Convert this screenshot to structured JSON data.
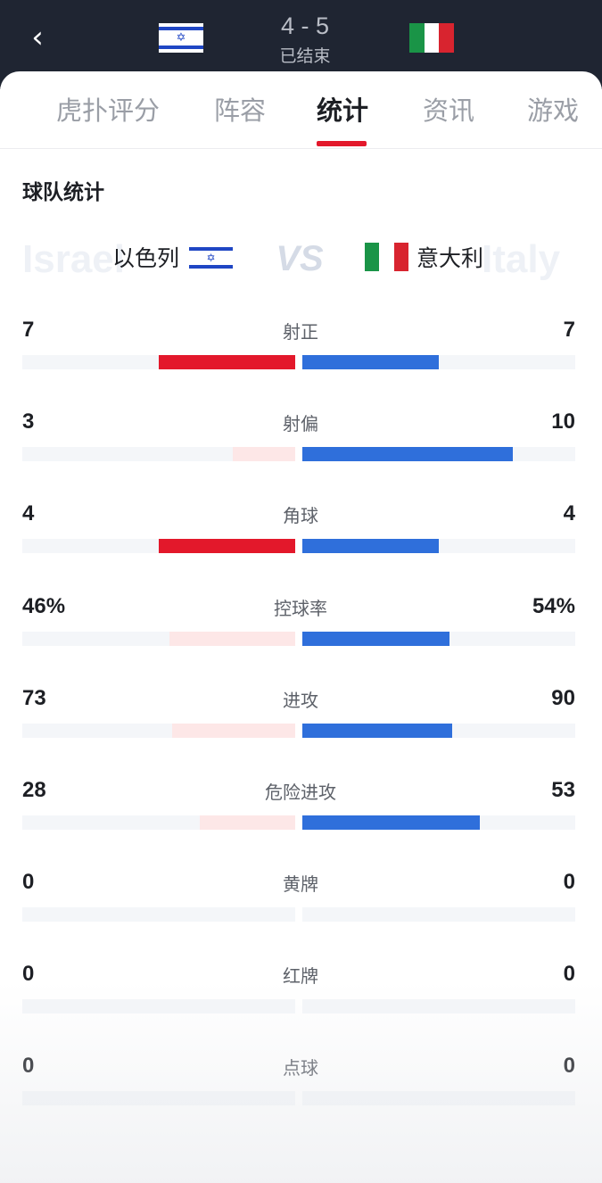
{
  "header": {
    "score": "4 - 5",
    "status": "已结束"
  },
  "tabs": [
    {
      "label": "虎扑评分",
      "active": false
    },
    {
      "label": "阵容",
      "active": false
    },
    {
      "label": "统计",
      "active": true
    },
    {
      "label": "资讯",
      "active": false
    },
    {
      "label": "游戏",
      "active": false
    }
  ],
  "section": {
    "title": "球队统计"
  },
  "banner": {
    "home_bg_text": "Israel",
    "away_bg_text": "Italy",
    "vs": "VS",
    "home_name": "以色列",
    "away_name": "意大利"
  },
  "colors": {
    "home_strong": "#e3182b",
    "home_weak": "#fde7e7",
    "away_strong": "#2f6fdb",
    "track": "#f4f6f9",
    "header_bg": "#1f2532"
  },
  "stats": [
    {
      "label": "射正",
      "home": "7",
      "away": "7",
      "home_frac": 0.5,
      "away_frac": 0.5,
      "home_leads": true
    },
    {
      "label": "射偏",
      "home": "3",
      "away": "10",
      "home_frac": 0.23,
      "away_frac": 0.77,
      "home_leads": false
    },
    {
      "label": "角球",
      "home": "4",
      "away": "4",
      "home_frac": 0.5,
      "away_frac": 0.5,
      "home_leads": true
    },
    {
      "label": "控球率",
      "home": "46%",
      "away": "54%",
      "home_frac": 0.46,
      "away_frac": 0.54,
      "home_leads": false
    },
    {
      "label": "进攻",
      "home": "73",
      "away": "90",
      "home_frac": 0.45,
      "away_frac": 0.55,
      "home_leads": false
    },
    {
      "label": "危险进攻",
      "home": "28",
      "away": "53",
      "home_frac": 0.35,
      "away_frac": 0.65,
      "home_leads": false
    },
    {
      "label": "黄牌",
      "home": "0",
      "away": "0",
      "home_frac": 0,
      "away_frac": 0,
      "home_leads": false
    },
    {
      "label": "红牌",
      "home": "0",
      "away": "0",
      "home_frac": 0,
      "away_frac": 0,
      "home_leads": false
    },
    {
      "label": "点球",
      "home": "0",
      "away": "0",
      "home_frac": 0,
      "away_frac": 0,
      "home_leads": false
    }
  ]
}
